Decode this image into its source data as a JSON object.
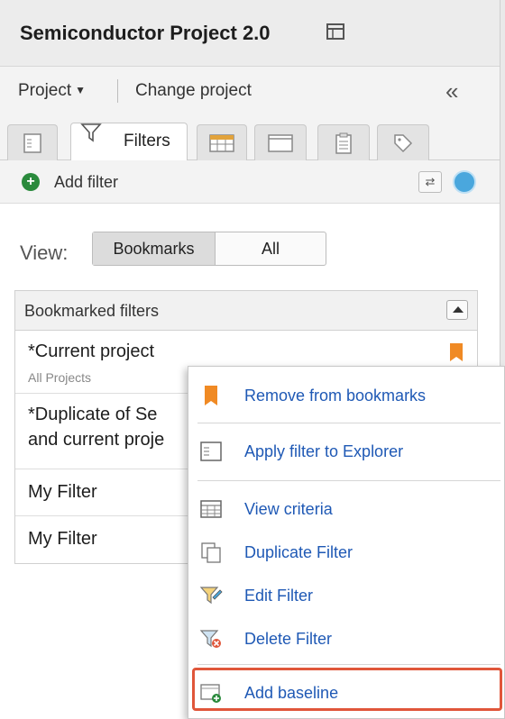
{
  "header": {
    "title": "Semiconductor Project 2.0",
    "title_icon": "panel-icon"
  },
  "toolbar": {
    "project_menu": "Project",
    "change_project": "Change project",
    "collapse_glyph": "«"
  },
  "tabs": [
    {
      "name": "explorer",
      "icon": "explorer-icon"
    },
    {
      "name": "filters",
      "label": "Filters",
      "icon": "filter-icon",
      "active": true
    },
    {
      "name": "grid",
      "icon": "grid-icon"
    },
    {
      "name": "window",
      "icon": "window-icon"
    },
    {
      "name": "clipboard",
      "icon": "clipboard-icon"
    },
    {
      "name": "tag",
      "icon": "tag-icon"
    }
  ],
  "addbar": {
    "add_filter": "Add filter",
    "sync_glyph": "⇄"
  },
  "view": {
    "label": "View:",
    "bookmarks": "Bookmarks",
    "all": "All",
    "selected": "Bookmarks"
  },
  "list": {
    "header": "Bookmarked filters",
    "rows": [
      {
        "title": "*Current project",
        "subtitle": "All Projects",
        "bookmarked": true
      },
      {
        "title_line1": "*Duplicate of Se",
        "title_line2": "and current proje"
      },
      {
        "title": "My Filter"
      },
      {
        "title": "My Filter"
      }
    ]
  },
  "context_menu": {
    "items": [
      {
        "label": "Remove from bookmarks",
        "icon": "bookmark-icon"
      },
      {
        "label": "Apply filter to Explorer",
        "icon": "explorer-icon"
      },
      {
        "label": "View criteria",
        "icon": "table-icon"
      },
      {
        "label": "Duplicate Filter",
        "icon": "duplicate-icon"
      },
      {
        "label": "Edit Filter",
        "icon": "edit-filter-icon"
      },
      {
        "label": "Delete Filter",
        "icon": "delete-filter-icon"
      },
      {
        "label": "Add baseline",
        "icon": "add-baseline-icon",
        "highlighted": true
      }
    ]
  },
  "colors": {
    "accent_orange": "#f08a24",
    "link_blue": "#1f59b5",
    "highlight_red": "#e0563a",
    "add_green": "#2a8a3c"
  }
}
